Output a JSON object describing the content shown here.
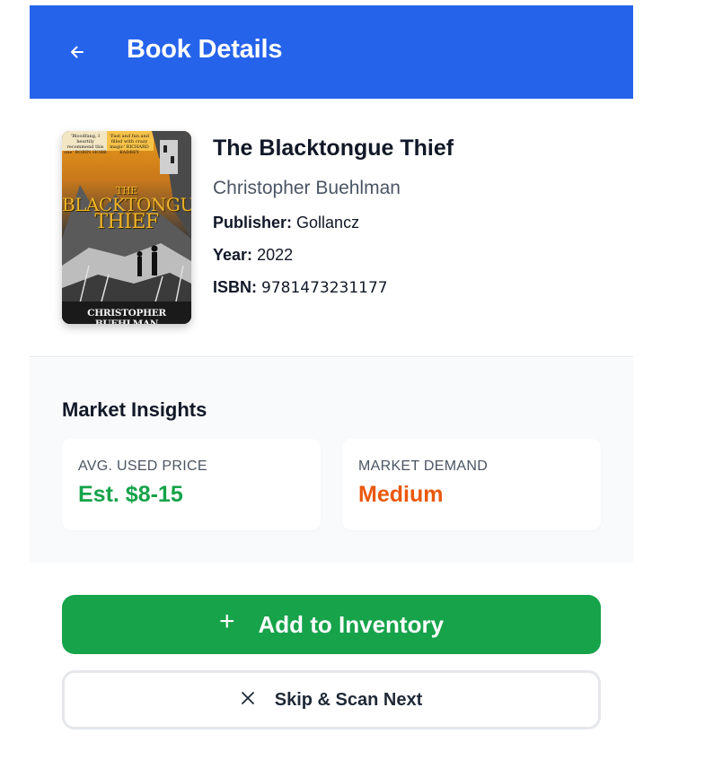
{
  "header": {
    "title": "Book Details",
    "back_icon": "arrow-left-icon",
    "background": "#2563eb"
  },
  "book": {
    "title": "The Blacktongue Thief",
    "author": "Christopher Buehlman",
    "publisher_label": "Publisher:",
    "publisher": "Gollancz",
    "year_label": "Year:",
    "year": "2022",
    "isbn_label": "ISBN:",
    "isbn": "9781473231177",
    "cover": {
      "title_line1": "THE",
      "title_line2": "BLACKTONGUE",
      "title_line3": "THIEF",
      "author": "CHRISTOPHER BUEHLMAN",
      "blurb_left": "'Bloodfang, I heartily recommend this one' ROBIN HOBB",
      "blurb_right": "'Fast and fun and filled with crazy magic' RICHARD KADREY"
    }
  },
  "market": {
    "heading": "Market Insights",
    "price_label": "AVG. USED PRICE",
    "price_value": "Est. $8-15",
    "demand_label": "MARKET DEMAND",
    "demand_value": "Medium",
    "price_color": "#16a34a",
    "demand_color": "#ea580c"
  },
  "actions": {
    "add_icon": "plus-icon",
    "add_label": "Add to Inventory",
    "add_color": "#16a34a",
    "skip_icon": "close-icon",
    "skip_label": "Skip & Scan Next"
  }
}
